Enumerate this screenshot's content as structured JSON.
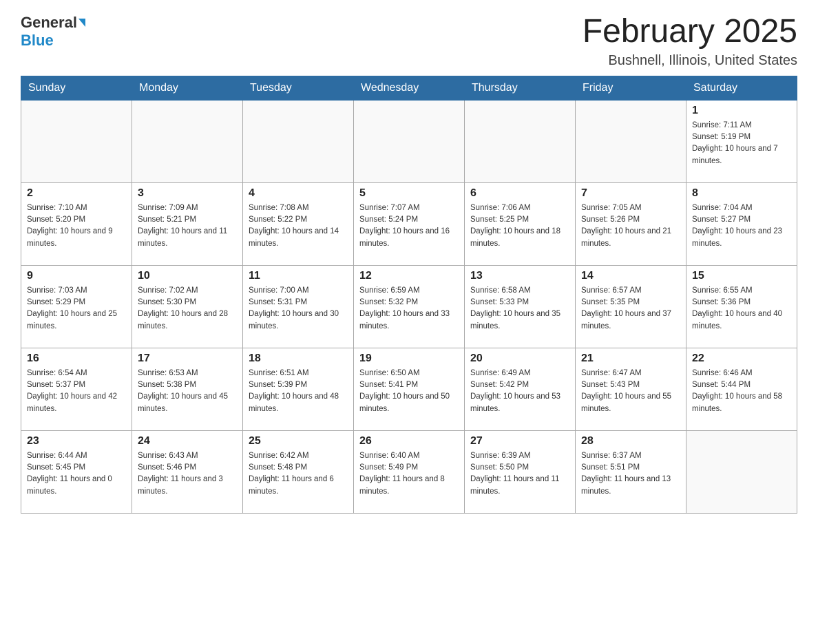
{
  "header": {
    "logo_general": "General",
    "logo_blue": "Blue",
    "month_title": "February 2025",
    "location": "Bushnell, Illinois, United States"
  },
  "days_of_week": [
    "Sunday",
    "Monday",
    "Tuesday",
    "Wednesday",
    "Thursday",
    "Friday",
    "Saturday"
  ],
  "weeks": [
    [
      {
        "day": "",
        "sunrise": "",
        "sunset": "",
        "daylight": ""
      },
      {
        "day": "",
        "sunrise": "",
        "sunset": "",
        "daylight": ""
      },
      {
        "day": "",
        "sunrise": "",
        "sunset": "",
        "daylight": ""
      },
      {
        "day": "",
        "sunrise": "",
        "sunset": "",
        "daylight": ""
      },
      {
        "day": "",
        "sunrise": "",
        "sunset": "",
        "daylight": ""
      },
      {
        "day": "",
        "sunrise": "",
        "sunset": "",
        "daylight": ""
      },
      {
        "day": "1",
        "sunrise": "Sunrise: 7:11 AM",
        "sunset": "Sunset: 5:19 PM",
        "daylight": "Daylight: 10 hours and 7 minutes."
      }
    ],
    [
      {
        "day": "2",
        "sunrise": "Sunrise: 7:10 AM",
        "sunset": "Sunset: 5:20 PM",
        "daylight": "Daylight: 10 hours and 9 minutes."
      },
      {
        "day": "3",
        "sunrise": "Sunrise: 7:09 AM",
        "sunset": "Sunset: 5:21 PM",
        "daylight": "Daylight: 10 hours and 11 minutes."
      },
      {
        "day": "4",
        "sunrise": "Sunrise: 7:08 AM",
        "sunset": "Sunset: 5:22 PM",
        "daylight": "Daylight: 10 hours and 14 minutes."
      },
      {
        "day": "5",
        "sunrise": "Sunrise: 7:07 AM",
        "sunset": "Sunset: 5:24 PM",
        "daylight": "Daylight: 10 hours and 16 minutes."
      },
      {
        "day": "6",
        "sunrise": "Sunrise: 7:06 AM",
        "sunset": "Sunset: 5:25 PM",
        "daylight": "Daylight: 10 hours and 18 minutes."
      },
      {
        "day": "7",
        "sunrise": "Sunrise: 7:05 AM",
        "sunset": "Sunset: 5:26 PM",
        "daylight": "Daylight: 10 hours and 21 minutes."
      },
      {
        "day": "8",
        "sunrise": "Sunrise: 7:04 AM",
        "sunset": "Sunset: 5:27 PM",
        "daylight": "Daylight: 10 hours and 23 minutes."
      }
    ],
    [
      {
        "day": "9",
        "sunrise": "Sunrise: 7:03 AM",
        "sunset": "Sunset: 5:29 PM",
        "daylight": "Daylight: 10 hours and 25 minutes."
      },
      {
        "day": "10",
        "sunrise": "Sunrise: 7:02 AM",
        "sunset": "Sunset: 5:30 PM",
        "daylight": "Daylight: 10 hours and 28 minutes."
      },
      {
        "day": "11",
        "sunrise": "Sunrise: 7:00 AM",
        "sunset": "Sunset: 5:31 PM",
        "daylight": "Daylight: 10 hours and 30 minutes."
      },
      {
        "day": "12",
        "sunrise": "Sunrise: 6:59 AM",
        "sunset": "Sunset: 5:32 PM",
        "daylight": "Daylight: 10 hours and 33 minutes."
      },
      {
        "day": "13",
        "sunrise": "Sunrise: 6:58 AM",
        "sunset": "Sunset: 5:33 PM",
        "daylight": "Daylight: 10 hours and 35 minutes."
      },
      {
        "day": "14",
        "sunrise": "Sunrise: 6:57 AM",
        "sunset": "Sunset: 5:35 PM",
        "daylight": "Daylight: 10 hours and 37 minutes."
      },
      {
        "day": "15",
        "sunrise": "Sunrise: 6:55 AM",
        "sunset": "Sunset: 5:36 PM",
        "daylight": "Daylight: 10 hours and 40 minutes."
      }
    ],
    [
      {
        "day": "16",
        "sunrise": "Sunrise: 6:54 AM",
        "sunset": "Sunset: 5:37 PM",
        "daylight": "Daylight: 10 hours and 42 minutes."
      },
      {
        "day": "17",
        "sunrise": "Sunrise: 6:53 AM",
        "sunset": "Sunset: 5:38 PM",
        "daylight": "Daylight: 10 hours and 45 minutes."
      },
      {
        "day": "18",
        "sunrise": "Sunrise: 6:51 AM",
        "sunset": "Sunset: 5:39 PM",
        "daylight": "Daylight: 10 hours and 48 minutes."
      },
      {
        "day": "19",
        "sunrise": "Sunrise: 6:50 AM",
        "sunset": "Sunset: 5:41 PM",
        "daylight": "Daylight: 10 hours and 50 minutes."
      },
      {
        "day": "20",
        "sunrise": "Sunrise: 6:49 AM",
        "sunset": "Sunset: 5:42 PM",
        "daylight": "Daylight: 10 hours and 53 minutes."
      },
      {
        "day": "21",
        "sunrise": "Sunrise: 6:47 AM",
        "sunset": "Sunset: 5:43 PM",
        "daylight": "Daylight: 10 hours and 55 minutes."
      },
      {
        "day": "22",
        "sunrise": "Sunrise: 6:46 AM",
        "sunset": "Sunset: 5:44 PM",
        "daylight": "Daylight: 10 hours and 58 minutes."
      }
    ],
    [
      {
        "day": "23",
        "sunrise": "Sunrise: 6:44 AM",
        "sunset": "Sunset: 5:45 PM",
        "daylight": "Daylight: 11 hours and 0 minutes."
      },
      {
        "day": "24",
        "sunrise": "Sunrise: 6:43 AM",
        "sunset": "Sunset: 5:46 PM",
        "daylight": "Daylight: 11 hours and 3 minutes."
      },
      {
        "day": "25",
        "sunrise": "Sunrise: 6:42 AM",
        "sunset": "Sunset: 5:48 PM",
        "daylight": "Daylight: 11 hours and 6 minutes."
      },
      {
        "day": "26",
        "sunrise": "Sunrise: 6:40 AM",
        "sunset": "Sunset: 5:49 PM",
        "daylight": "Daylight: 11 hours and 8 minutes."
      },
      {
        "day": "27",
        "sunrise": "Sunrise: 6:39 AM",
        "sunset": "Sunset: 5:50 PM",
        "daylight": "Daylight: 11 hours and 11 minutes."
      },
      {
        "day": "28",
        "sunrise": "Sunrise: 6:37 AM",
        "sunset": "Sunset: 5:51 PM",
        "daylight": "Daylight: 11 hours and 13 minutes."
      },
      {
        "day": "",
        "sunrise": "",
        "sunset": "",
        "daylight": ""
      }
    ]
  ]
}
